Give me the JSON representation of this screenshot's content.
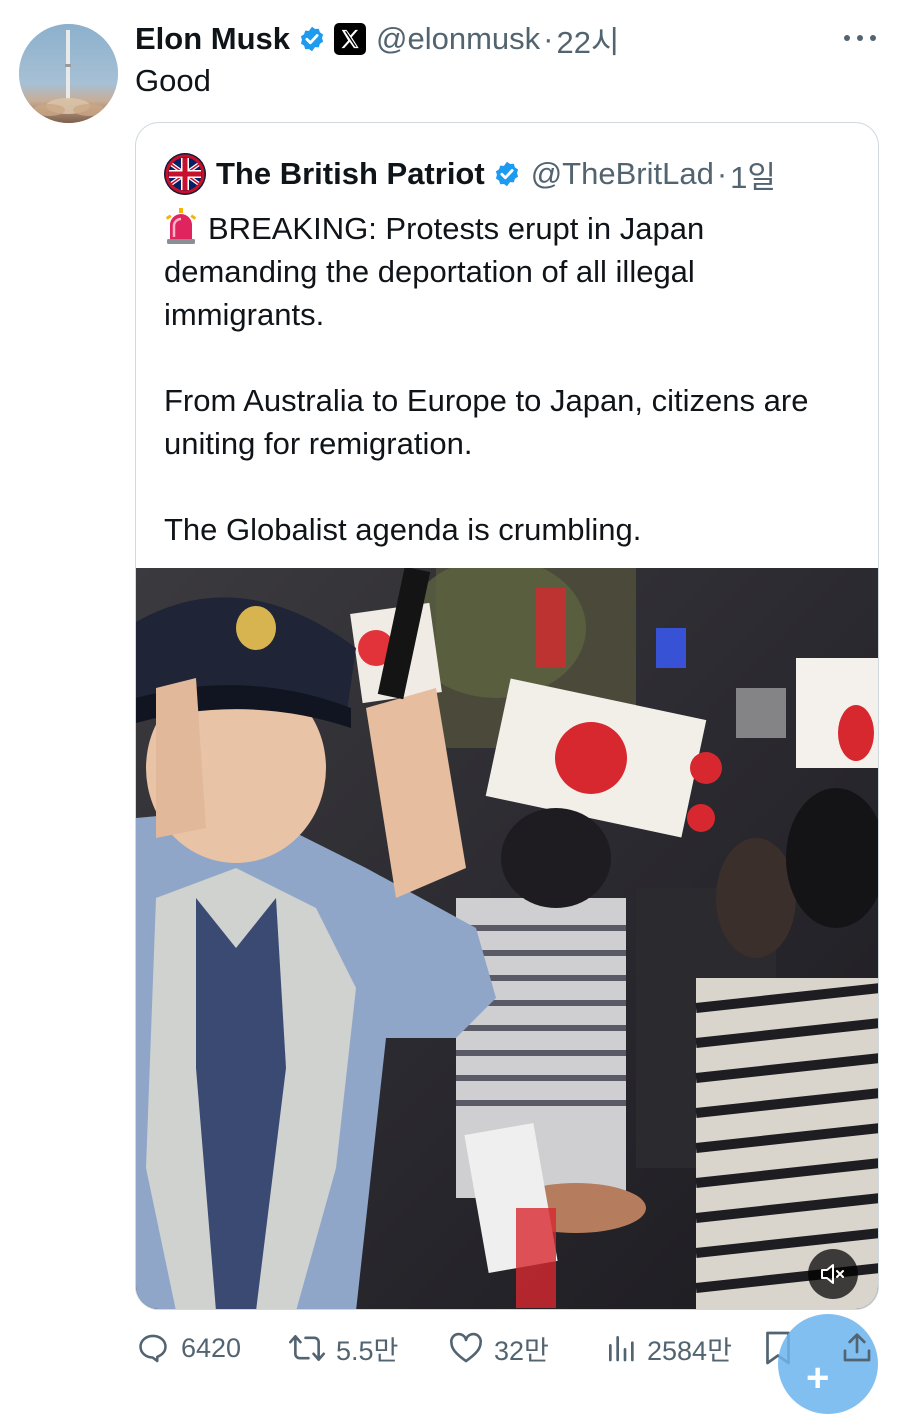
{
  "tweet": {
    "author_name": "Elon Musk",
    "handle": "@elonmusk",
    "separator": "·",
    "time": "22시",
    "text": "Good",
    "avatar_icon": "rocket-launch-avatar",
    "more_icon": "more-dots-icon"
  },
  "quote": {
    "author_name": "The British Patriot",
    "handle": "@TheBritLad",
    "separator": "·",
    "time": "1일",
    "siren_icon": "rotating-light-emoji",
    "paragraphs": [
      "BREAKING: Protests erupt in Japan demanding the deportation of all illegal immigrants.",
      "From Australia to Europe to Japan, citizens are uniting for remigration.",
      "The Globalist agenda is crumbling."
    ],
    "media": {
      "type": "video",
      "mute_icon": "volume-muted-icon"
    }
  },
  "actions": {
    "replies": "6420",
    "reposts": "5.5만",
    "likes": "32만",
    "views": "2584만"
  },
  "colors": {
    "verified": "#1d9bf0",
    "text": "#0f1419",
    "secondary": "#536471",
    "border": "#cfd9de"
  }
}
